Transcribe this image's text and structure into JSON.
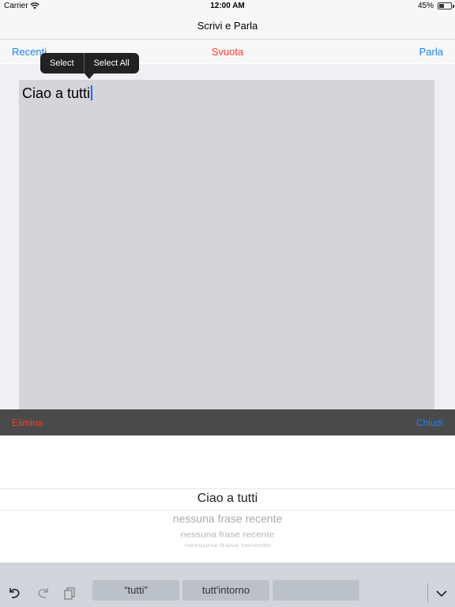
{
  "status": {
    "carrier": "Carrier",
    "time": "12:00 AM",
    "battery": "45%"
  },
  "nav": {
    "title": "Scrivi e Parla"
  },
  "toolbar": {
    "recenti": "Recenti",
    "svuota": "Svuota",
    "parla": "Parla"
  },
  "callout": {
    "select": "Select",
    "select_all": "Select All"
  },
  "editor": {
    "text": "Ciao a tutti"
  },
  "darkbar": {
    "elimina": "Elimina",
    "chiudi": "Chiudi"
  },
  "picker": {
    "selected": "Ciao a tutti",
    "items": [
      "nessuna frase recente",
      "nessuna frase recente",
      "nessuna frase recente"
    ]
  },
  "keyboard": {
    "suggestions": [
      "“tutti”",
      "tutt'intorno",
      ""
    ]
  },
  "colors": {
    "blue": "#1a82fb",
    "red": "#ff3b30",
    "editor_bg": "#d4d4d9",
    "dark_bar": "#4a4a4a"
  },
  "icons": [
    "wifi-icon",
    "battery-icon",
    "undo-icon",
    "redo-icon",
    "paste-icon",
    "chevron-down-icon"
  ]
}
